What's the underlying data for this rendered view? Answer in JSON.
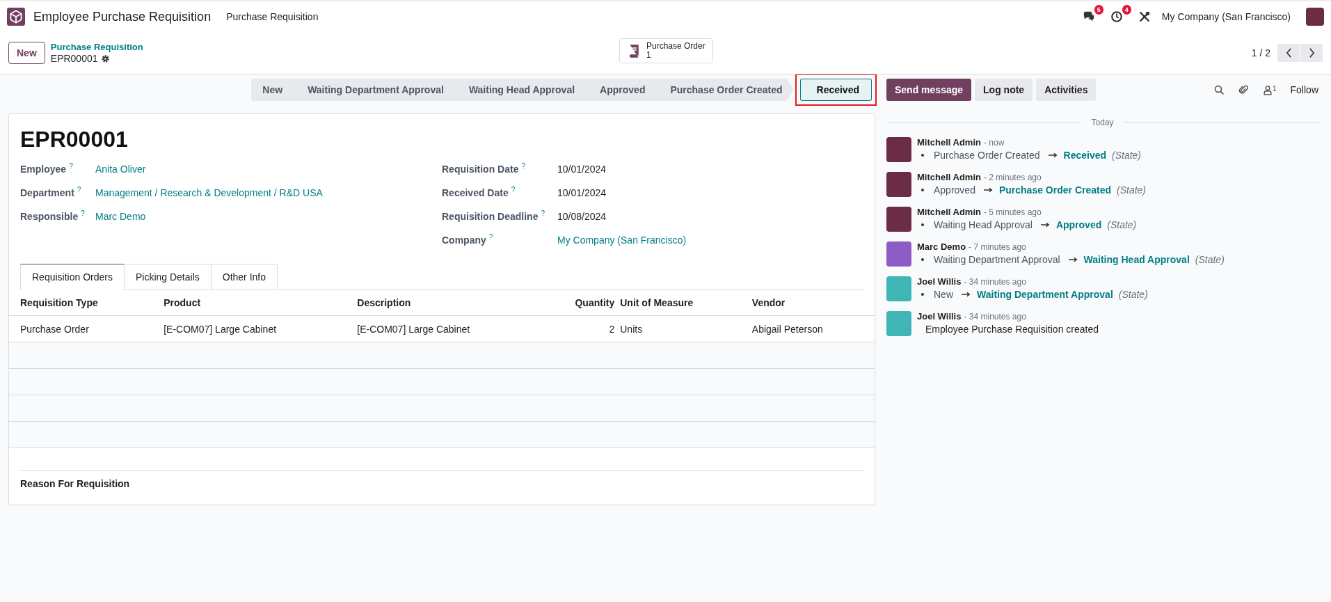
{
  "navbar": {
    "app_name": "Employee Purchase Requisition",
    "menu": [
      "Purchase Requisition"
    ],
    "messages_badge": "5",
    "activities_badge": "4",
    "company": "My Company (San Francisco)"
  },
  "control_panel": {
    "new_button": "New",
    "breadcrumb": "Purchase Requisition",
    "record": "EPR00001",
    "smart_button": {
      "label": "Purchase Order",
      "count": "1"
    },
    "pager": "1 / 2"
  },
  "statusbar": [
    {
      "label": "New",
      "selected": false
    },
    {
      "label": "Waiting Department Approval",
      "selected": false
    },
    {
      "label": "Waiting Head Approval",
      "selected": false
    },
    {
      "label": "Approved",
      "selected": false
    },
    {
      "label": "Purchase Order Created",
      "selected": false
    },
    {
      "label": "Received",
      "selected": true
    }
  ],
  "form": {
    "title": "EPR00001",
    "left_fields": [
      {
        "label": "Employee",
        "help": "?",
        "value": "Anita Oliver",
        "kind": "link"
      },
      {
        "label": "Department",
        "help": "?",
        "value": "Management / Research & Development / R&D USA",
        "kind": "link"
      },
      {
        "label": "Responsible",
        "help": "?",
        "value": "Marc Demo",
        "kind": "link"
      }
    ],
    "right_fields": [
      {
        "label": "Requisition Date",
        "help": "?",
        "value": "10/01/2024",
        "kind": "text"
      },
      {
        "label": "Received Date",
        "help": "?",
        "value": "10/01/2024",
        "kind": "text"
      },
      {
        "label": "Requisition Deadline",
        "help": "?",
        "value": "10/08/2024",
        "kind": "text"
      },
      {
        "label": "Company",
        "help": "?",
        "value": "My Company (San Francisco)",
        "kind": "link"
      }
    ],
    "tabs": [
      {
        "label": "Requisition Orders",
        "selected": true
      },
      {
        "label": "Picking Details",
        "selected": false
      },
      {
        "label": "Other Info",
        "selected": false
      }
    ],
    "table": {
      "columns": [
        "Requisition Type",
        "Product",
        "Description",
        "Quantity",
        "Unit of Measure",
        "Vendor"
      ],
      "rows": [
        [
          "Purchase Order",
          "[E-COM07] Large Cabinet",
          "[E-COM07] Large Cabinet",
          "2",
          "Units",
          "Abigail Peterson"
        ]
      ]
    },
    "reason_label": "Reason For Requisition"
  },
  "chatter": {
    "buttons": [
      "Send message",
      "Log note",
      "Activities"
    ],
    "followers_count": "1",
    "follow": "Follow",
    "date_separator": "Today",
    "messages": [
      {
        "author": "Mitchell Admin",
        "time": "- now",
        "color": "#6b2d45",
        "kind": "change",
        "old": "Purchase Order Created",
        "new": "Received",
        "field": "(State)"
      },
      {
        "author": "Mitchell Admin",
        "time": "- 2 minutes ago",
        "color": "#6b2d45",
        "kind": "change",
        "old": "Approved",
        "new": "Purchase Order Created",
        "field": "(State)"
      },
      {
        "author": "Mitchell Admin",
        "time": "- 5 minutes ago",
        "color": "#6b2d45",
        "kind": "change",
        "old": "Waiting Head Approval",
        "new": "Approved",
        "field": "(State)"
      },
      {
        "author": "Marc Demo",
        "time": "- 7 minutes ago",
        "color": "#8e5cc4",
        "kind": "change",
        "old": "Waiting Department Approval",
        "new": "Waiting Head Approval",
        "field": "(State)"
      },
      {
        "author": "Joel Willis",
        "time": "- 34 minutes ago",
        "color": "#3fb5b5",
        "kind": "change",
        "old": "New",
        "new": "Waiting Department Approval",
        "field": "(State)"
      },
      {
        "author": "Joel Willis",
        "time": "- 34 minutes ago",
        "color": "#3fb5b5",
        "kind": "note",
        "body": "Employee Purchase Requisition created"
      }
    ]
  }
}
